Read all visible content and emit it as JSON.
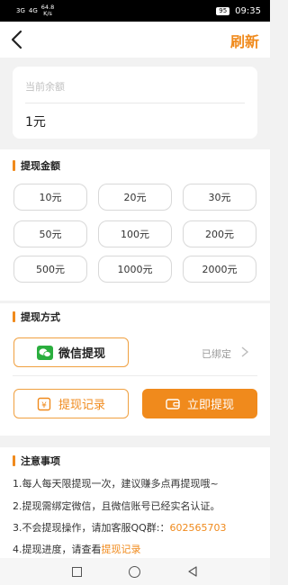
{
  "status_bar": {
    "signal1": "3G",
    "signal2": "4G",
    "net_speed": "64.8",
    "net_unit": "K/s",
    "battery": "95",
    "time": "09:35"
  },
  "nav": {
    "refresh_label": "刷新"
  },
  "balance": {
    "label": "当前余额",
    "value": "1元"
  },
  "amount_section": {
    "title": "提现金额",
    "options": [
      "10元",
      "20元",
      "30元",
      "50元",
      "100元",
      "200元",
      "500元",
      "1000元",
      "2000元"
    ]
  },
  "method_section": {
    "title": "提现方式",
    "method_label": "微信提现",
    "bound_label": "已绑定"
  },
  "actions": {
    "record_label": "提现记录",
    "withdraw_label": "立即提现"
  },
  "notes": {
    "title": "注意事项",
    "line1": "1.每人每天限提现一次，建议赚多点再提现哦~",
    "line2": "2.提现需绑定微信，且微信账号已经实名认证。",
    "line3_prefix": "3.不会提现操作，请加客服QQ群:：",
    "line3_qq": "602565703",
    "line4_prefix": "4.提现进度，请查看",
    "line4_link": "提现记录"
  },
  "colors": {
    "accent": "#f08a1c",
    "wechat": "#2aae3e"
  }
}
